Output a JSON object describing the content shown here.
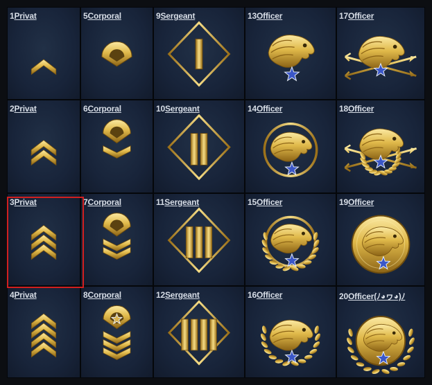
{
  "colors": {
    "selection": "#d21f1f",
    "gold": "#e0b94a",
    "star": "#3b57c8",
    "tile": "#1a263a"
  },
  "selected_rank": "3",
  "cells": [
    {
      "number": "1",
      "rank": "Privat",
      "icon": "private-1-chevron-icon"
    },
    {
      "number": "5",
      "rank": "Corporal",
      "icon": "corporal-1-icon"
    },
    {
      "number": "9",
      "rank": "Sergeant",
      "icon": "sergeant-1-bar-icon"
    },
    {
      "number": "13",
      "rank": "Officer",
      "icon": "officer-eagle-star-icon"
    },
    {
      "number": "17",
      "rank": "Officer",
      "icon": "officer-eagle-arrows-icon"
    },
    {
      "number": "2",
      "rank": "Privat",
      "icon": "private-2-chevron-icon"
    },
    {
      "number": "6",
      "rank": "Corporal",
      "icon": "corporal-2-icon"
    },
    {
      "number": "10",
      "rank": "Sergeant",
      "icon": "sergeant-2-bar-icon"
    },
    {
      "number": "14",
      "rank": "Officer",
      "icon": "officer-eagle-ring-icon"
    },
    {
      "number": "18",
      "rank": "Officer",
      "icon": "officer-eagle-arrows-wreath-icon"
    },
    {
      "number": "3",
      "rank": "Privat",
      "icon": "private-3-chevron-icon"
    },
    {
      "number": "7",
      "rank": "Corporal",
      "icon": "corporal-3-icon"
    },
    {
      "number": "11",
      "rank": "Sergeant",
      "icon": "sergeant-3-bar-icon"
    },
    {
      "number": "15",
      "rank": "Officer",
      "icon": "officer-eagle-ring-wreath-icon"
    },
    {
      "number": "19",
      "rank": "Officer",
      "icon": "officer-eagle-medal-icon"
    },
    {
      "number": "4",
      "rank": "Privat",
      "icon": "private-4-chevron-icon"
    },
    {
      "number": "8",
      "rank": "Corporal",
      "icon": "corporal-4-star-icon"
    },
    {
      "number": "12",
      "rank": "Sergeant",
      "icon": "sergeant-4-bar-icon"
    },
    {
      "number": "16",
      "rank": "Officer",
      "icon": "officer-eagle-laurel-icon"
    },
    {
      "number": "20",
      "rank": "Officer(ﾉ◕ヮ◕)ﾉ",
      "icon": "officer-eagle-gold-medal-icon"
    }
  ]
}
